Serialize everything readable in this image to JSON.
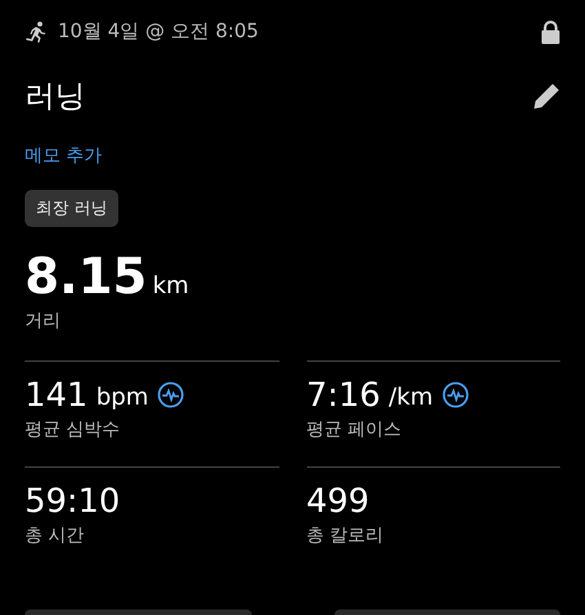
{
  "header": {
    "date": "10월 4일 @ 오전 8:05"
  },
  "title": "러닝",
  "memo_link": "메모 추가",
  "badge": "최장 러닝",
  "distance": {
    "value": "8.15",
    "unit": "km",
    "label": "거리"
  },
  "metrics": [
    {
      "value": "141",
      "unit": "bpm",
      "label": "평균 심박수",
      "graph": true
    },
    {
      "value": "7:16",
      "unit": "/km",
      "label": "평균 페이스",
      "graph": true
    },
    {
      "value": "59:10",
      "label": "총 시간",
      "graph": false
    },
    {
      "value": "499",
      "label": "총 칼로리",
      "graph": false
    }
  ]
}
